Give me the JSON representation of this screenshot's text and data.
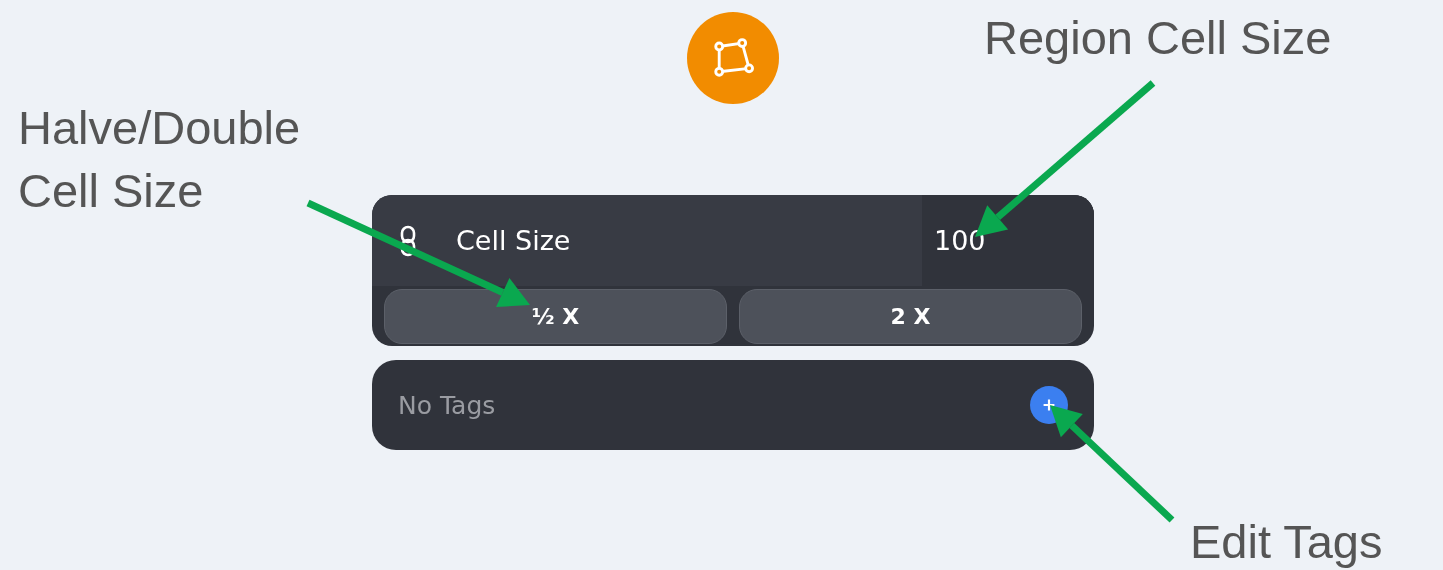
{
  "annotations": [
    {
      "text": "Region Cell Size"
    },
    {
      "text": "Halve/Double Cell Size"
    },
    {
      "text": "Edit Tags"
    }
  ],
  "cell_size": {
    "label": "Cell Size",
    "value": "100",
    "buttons": [
      "½ X",
      "2 X"
    ]
  },
  "tags": {
    "text": "No Tags"
  }
}
